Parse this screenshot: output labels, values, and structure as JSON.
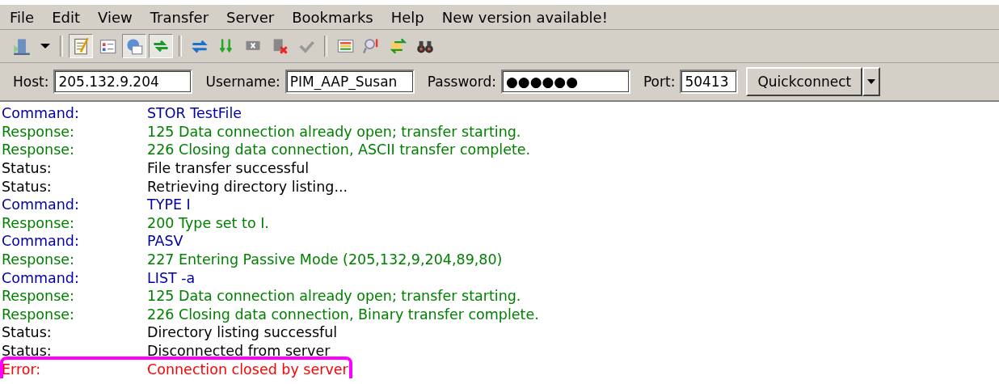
{
  "menu": [
    "File",
    "Edit",
    "View",
    "Transfer",
    "Server",
    "Bookmarks",
    "Help",
    "New version available!"
  ],
  "toolbar": [
    {
      "kind": "sitemanager"
    },
    {
      "kind": "caret"
    },
    {
      "kind": "sep"
    },
    {
      "kind": "log",
      "pressed": true
    },
    {
      "kind": "localtree",
      "pressed": false
    },
    {
      "kind": "remotetree",
      "pressed": true
    },
    {
      "kind": "queue",
      "pressed": true
    },
    {
      "kind": "sep"
    },
    {
      "kind": "refresh"
    },
    {
      "kind": "process"
    },
    {
      "kind": "cancel"
    },
    {
      "kind": "disconnect"
    },
    {
      "kind": "reconnect"
    },
    {
      "kind": "sep"
    },
    {
      "kind": "filter"
    },
    {
      "kind": "compare"
    },
    {
      "kind": "sync"
    },
    {
      "kind": "find"
    }
  ],
  "quickconnect": {
    "host_label": "Host:",
    "host": "205.132.9.204",
    "username_label": "Username:",
    "username": "PIM_AAP_Susan",
    "password_label": "Password:",
    "password": "●●●●●●",
    "port_label": "Port:",
    "port": "50413",
    "button": "Quickconnect"
  },
  "log": [
    {
      "kind": "command",
      "label": "Command:",
      "text": "STOR TestFile",
      "highlighted": false
    },
    {
      "kind": "response",
      "label": "Response:",
      "text": "125 Data connection already open; transfer starting.",
      "highlighted": false
    },
    {
      "kind": "response",
      "label": "Response:",
      "text": "226 Closing data connection, ASCII transfer complete.",
      "highlighted": false
    },
    {
      "kind": "status",
      "label": "Status:",
      "text": "File transfer successful",
      "highlighted": false
    },
    {
      "kind": "status",
      "label": "Status:",
      "text": "Retrieving directory listing...",
      "highlighted": false
    },
    {
      "kind": "command",
      "label": "Command:",
      "text": "TYPE I",
      "highlighted": false
    },
    {
      "kind": "response",
      "label": "Response:",
      "text": "200 Type set to I.",
      "highlighted": false
    },
    {
      "kind": "command",
      "label": "Command:",
      "text": "PASV",
      "highlighted": false
    },
    {
      "kind": "response",
      "label": "Response:",
      "text": "227 Entering Passive Mode (205,132,9,204,89,80)",
      "highlighted": false
    },
    {
      "kind": "command",
      "label": "Command:",
      "text": "LIST -a",
      "highlighted": false
    },
    {
      "kind": "response",
      "label": "Response:",
      "text": "125 Data connection already open; transfer starting.",
      "highlighted": false
    },
    {
      "kind": "response",
      "label": "Response:",
      "text": "226 Closing data connection, Binary transfer complete.",
      "highlighted": false
    },
    {
      "kind": "status",
      "label": "Status:",
      "text": "Directory listing successful",
      "highlighted": false
    },
    {
      "kind": "status",
      "label": "Status:",
      "text": "Disconnected from server",
      "highlighted": false
    },
    {
      "kind": "error",
      "label": "Error:",
      "text": "Connection closed by server",
      "highlighted": true
    }
  ]
}
